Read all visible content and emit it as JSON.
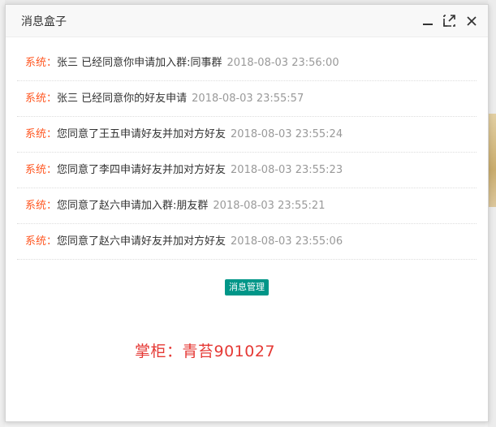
{
  "dialog": {
    "title": "消息盒子",
    "controls": {
      "minimize": "minimize-icon",
      "maximize": "maximize-icon",
      "close": "close-icon"
    }
  },
  "messages": [
    {
      "sender": "系统：",
      "text": "张三 已经同意你申请加入群:同事群",
      "time": "2018-08-03 23:56:00"
    },
    {
      "sender": "系统：",
      "text": "张三 已经同意你的好友申请",
      "time": "2018-08-03 23:55:57"
    },
    {
      "sender": "系统：",
      "text": "您同意了王五申请好友并加对方好友",
      "time": "2018-08-03 23:55:24"
    },
    {
      "sender": "系统：",
      "text": "您同意了李四申请好友并加对方好友",
      "time": "2018-08-03 23:55:23"
    },
    {
      "sender": "系统：",
      "text": "您同意了赵六申请加入群:朋友群",
      "time": "2018-08-03 23:55:21"
    },
    {
      "sender": "系统：",
      "text": "您同意了赵六申请好友并加对方好友",
      "time": "2018-08-03 23:55:06"
    }
  ],
  "manage_button": "消息管理",
  "watermark": "掌柜：青苔901027",
  "colors": {
    "system_label": "#ff5722",
    "time": "#999999",
    "button_bg": "#009688",
    "watermark": "#e53935"
  }
}
